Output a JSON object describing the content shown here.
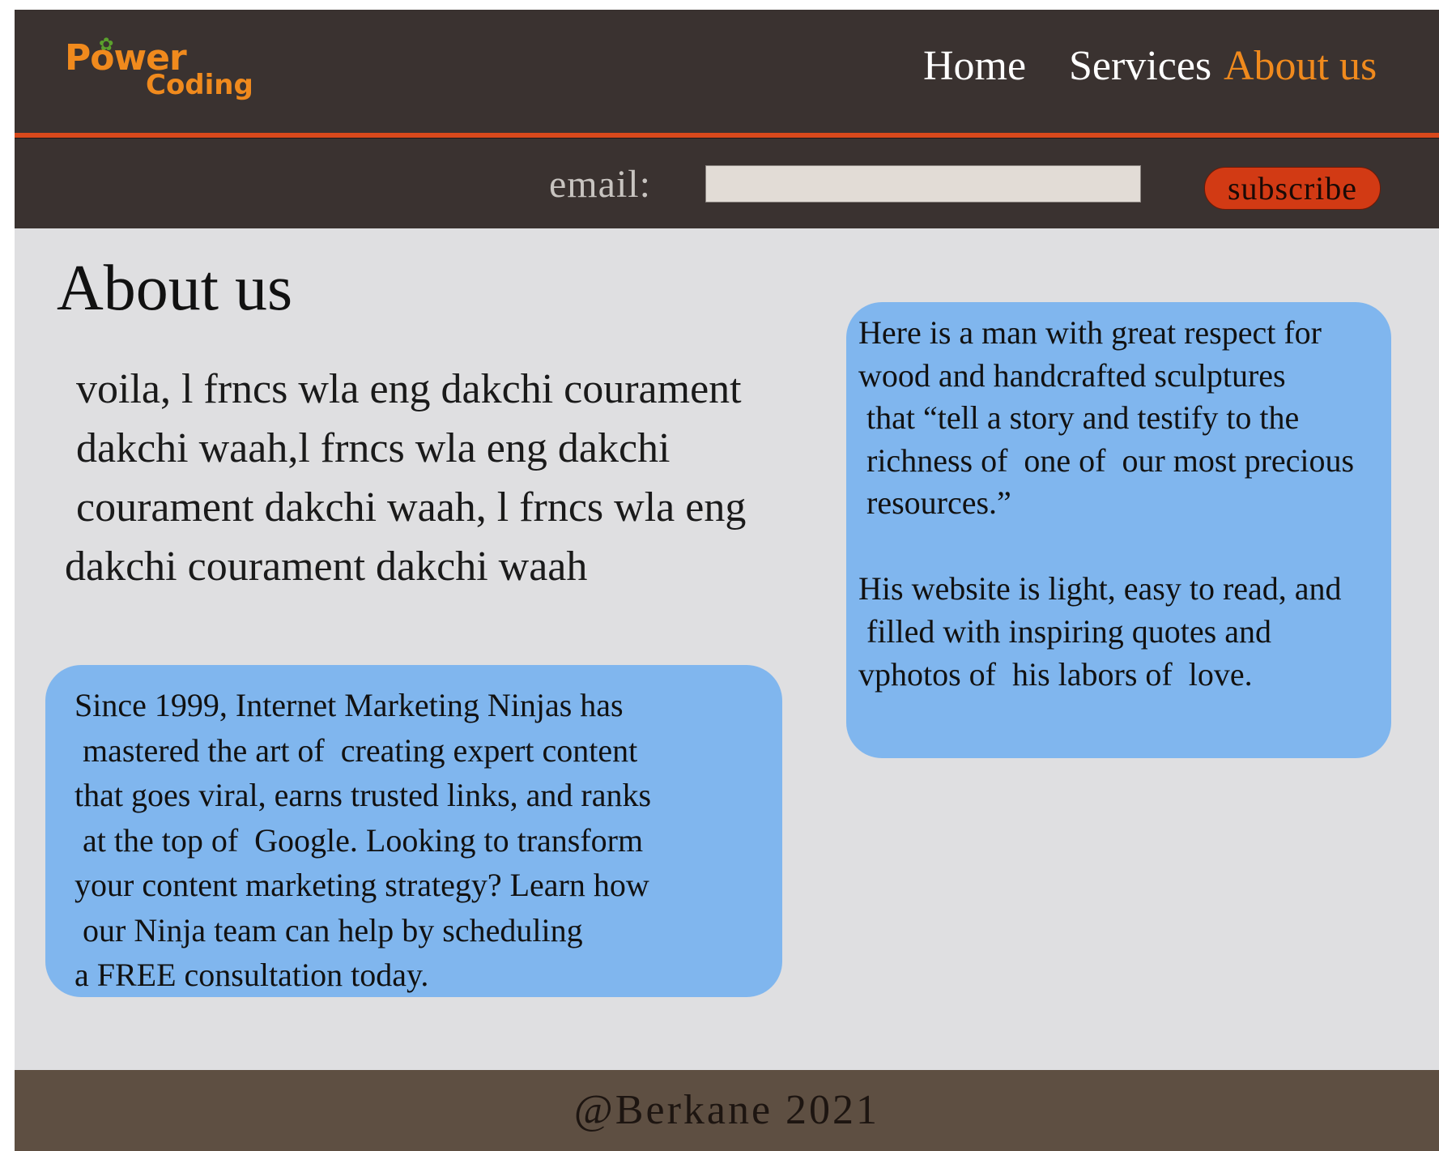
{
  "header": {
    "logo": {
      "line1": "Power",
      "line2": "Coding"
    },
    "nav": [
      {
        "label": "Home"
      },
      {
        "label": "Services"
      },
      {
        "label": "About us"
      }
    ],
    "active_color": "#f08a1d"
  },
  "subscribe_bar": {
    "email_label": "email:",
    "email_value": "",
    "button_label": "subscribe",
    "button_color": "#d23a14"
  },
  "main": {
    "title": "About us",
    "intro_lines": [
      "voila, l frncs wla eng dakchi courament",
      "dakchi waah,l frncs wla eng dakchi",
      "courament dakchi waah, l frncs wla eng",
      "dakchi courament dakchi waah"
    ],
    "left_box_lines": [
      "Since 1999, Internet Marketing Ninjas has",
      "mastered the art of  creating expert content",
      "that goes viral, earns trusted links, and ranks",
      "at the top of  Google. Looking to transform",
      "your content marketing strategy? Learn how",
      "our Ninja team can help by scheduling",
      "a FREE consultation today."
    ],
    "right_box": {
      "para1_lines": [
        "Here is a man with great respect for",
        "wood and handcrafted sculptures",
        "that “tell a story and testify to the",
        "richness of  one of  our most precious",
        "resources.”"
      ],
      "para2_lines": [
        "His website is light, easy to read, and",
        "filled with inspiring quotes and",
        "vphotos of  his labors of  love."
      ]
    },
    "box_color": "#80b6ee"
  },
  "footer": {
    "text": "@Berkane 2021"
  }
}
